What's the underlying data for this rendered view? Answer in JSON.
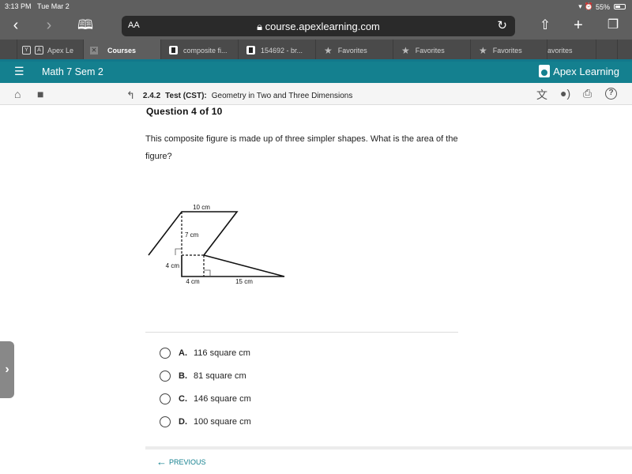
{
  "status_bar": {
    "time": "3:13 PM",
    "date": "Tue Mar 2",
    "battery": "55%"
  },
  "browser": {
    "text_size_label": "AA",
    "url": "course.apexlearning.com",
    "tabs": [
      {
        "label": "Apex Le",
        "favicon": "A",
        "pre_favicon": "Y",
        "active": false
      },
      {
        "label": "Courses",
        "active": true
      },
      {
        "label": "composite fi...",
        "active": false
      },
      {
        "label": "154692 - br...",
        "active": false
      },
      {
        "label": "Favorites",
        "active": false
      },
      {
        "label": "Favorites",
        "active": false
      },
      {
        "label": "Favorites",
        "active": false
      },
      {
        "label": "avorites",
        "active": false
      }
    ]
  },
  "app": {
    "course_title": "Math 7 Sem 2",
    "logo_text": "Apex Learning",
    "brand_color": "#14808f"
  },
  "breadcrumb": {
    "section": "2.4.2",
    "activity": "Test (CST):",
    "topic": "Geometry in Two and Three Dimensions"
  },
  "question": {
    "title": "Question 4 of 10",
    "text": "This composite figure is made up of three simpler shapes. What is the area of the figure?",
    "figure_labels": {
      "top": "10 cm",
      "height": "7 cm",
      "left_side": "4 cm",
      "bottom_left": "4 cm",
      "bottom_right": "15 cm"
    },
    "answers": [
      {
        "letter": "A.",
        "text": "116 square cm"
      },
      {
        "letter": "B.",
        "text": "81 square cm"
      },
      {
        "letter": "C.",
        "text": "146 square cm"
      },
      {
        "letter": "D.",
        "text": "100 square cm"
      }
    ]
  },
  "nav": {
    "previous_label": "PREVIOUS"
  }
}
